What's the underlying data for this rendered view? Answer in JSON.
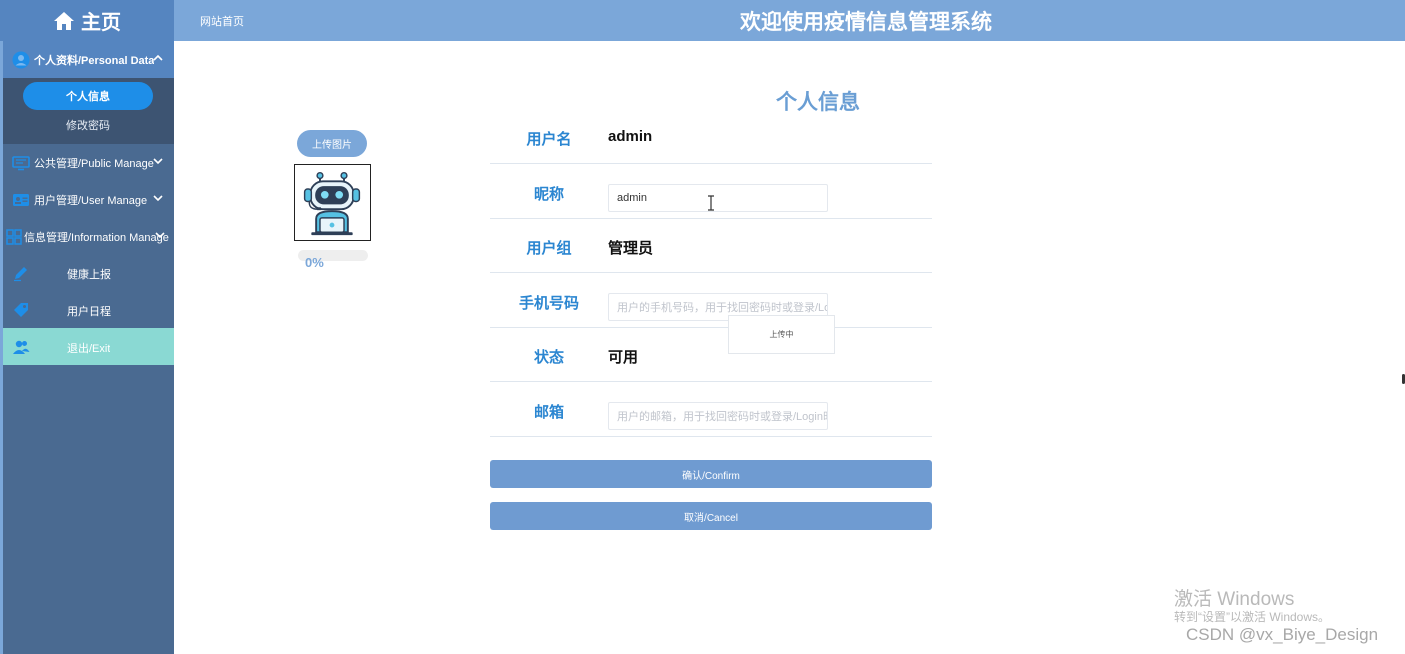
{
  "header": {
    "logo_text": "主页",
    "site_home": "网站首页",
    "system_title": "欢迎使用疫情信息管理系统"
  },
  "sidebar": {
    "personal": {
      "label": "个人资料/Personal Data",
      "icon": "person-circle-icon"
    },
    "personal_sub": [
      {
        "label": "个人信息",
        "active": true
      },
      {
        "label": "修改密码",
        "active": false
      }
    ],
    "public": {
      "label": "公共管理/Public Manage",
      "icon": "monitor-icon"
    },
    "user": {
      "label": "用户管理/User Manage",
      "icon": "id-card-icon"
    },
    "info": {
      "label": "信息管理/Information Manage",
      "icon": "grid-icon"
    },
    "health": {
      "label": "健康上报",
      "icon": "pen-icon"
    },
    "schedule": {
      "label": "用户日程",
      "icon": "tag-icon"
    },
    "exit": {
      "label": "退出/Exit",
      "icon": "users-icon"
    }
  },
  "main": {
    "page_title": "个人信息",
    "upload_button": "上传图片",
    "progress_text": "0%",
    "progress_value": 0,
    "tooltip": "上传中",
    "form": {
      "username": {
        "label": "用户名",
        "value": "admin"
      },
      "nickname": {
        "label": "昵称",
        "value": "admin"
      },
      "group": {
        "label": "用户组",
        "value": "管理员"
      },
      "phone": {
        "label": "手机号码",
        "placeholder": "用户的手机号码，用于找回密码时或登录/Login"
      },
      "status": {
        "label": "状态",
        "value": "可用"
      },
      "email": {
        "label": "邮箱",
        "placeholder": "用户的邮箱，用于找回密码时或登录/Login时"
      }
    },
    "confirm_button": "确认/Confirm",
    "cancel_button": "取消/Cancel"
  },
  "watermark": {
    "title": "激活 Windows",
    "subtitle": "转到“设置”以激活 Windows。",
    "csdn": "CSDN @vx_Biye_Design"
  },
  "colors": {
    "header": "#7ba7d9",
    "logo": "#5585c0",
    "sidebar": "#4a6a91",
    "active_sub": "#1e8ee8",
    "exit_item": "#8ad9d3",
    "label_blue": "#2b86d1",
    "button": "#6f9bd1"
  }
}
